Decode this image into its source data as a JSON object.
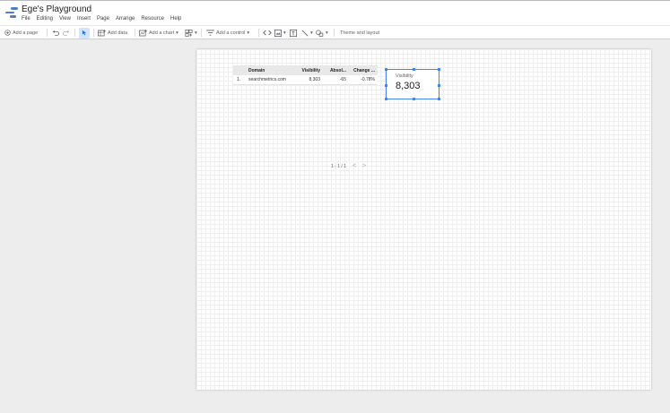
{
  "app": {
    "title": "Ege's Playground"
  },
  "menu": [
    "File",
    "Editing",
    "View",
    "Insert",
    "Page",
    "Arrange",
    "Resource",
    "Help"
  ],
  "toolbar": {
    "add_page": "Add a page",
    "add_data": "Add data",
    "add_chart": "Add a chart",
    "add_control": "Add a control",
    "theme": "Theme and layout"
  },
  "table": {
    "headers": [
      "",
      "Domain",
      "Visibility",
      "Absol...",
      "Change ..."
    ],
    "rows": [
      [
        "1.",
        "searchmetrics.com",
        "8,303",
        "-65",
        "-0.78%"
      ]
    ]
  },
  "pager": {
    "text": "1 - 1 / 1",
    "prev": "<",
    "next": ">"
  },
  "scorecard": {
    "label": "Visibility",
    "value": "8,303"
  },
  "colors": {
    "accent": "#4285f4",
    "logo": "#4e7ec9",
    "selected_tool": "#d2e3fc"
  }
}
